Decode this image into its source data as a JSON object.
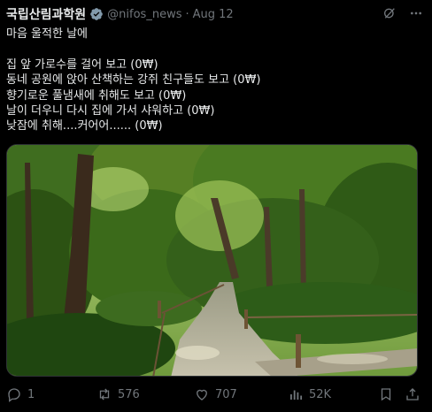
{
  "header": {
    "author": "국립산림과학원",
    "handle": "@nifos_news",
    "separator": "·",
    "date": "Aug 12"
  },
  "tweet": {
    "lines": [
      "마음 울적한 날에",
      "",
      "집 앞 가로수를 걸어 보고 (0₩)",
      "동네 공원에 앉아 산책하는 강쥐 친구들도 보고 (0₩)",
      "향기로운 풀냄새에 취해도 보고 (0₩)",
      "날이 더우니 다시 집에 가서 샤워하고 (0₩)",
      "낮잠에 취해....커어어...... (0₩)"
    ]
  },
  "media": {
    "description_icon": "forest-path-photo"
  },
  "actions": {
    "replies": "1",
    "reposts": "576",
    "likes": "707",
    "views": "52K"
  },
  "colors": {
    "background": "#000000",
    "text": "#e7e9ea",
    "muted": "#71767b",
    "verified": "#829aab"
  }
}
